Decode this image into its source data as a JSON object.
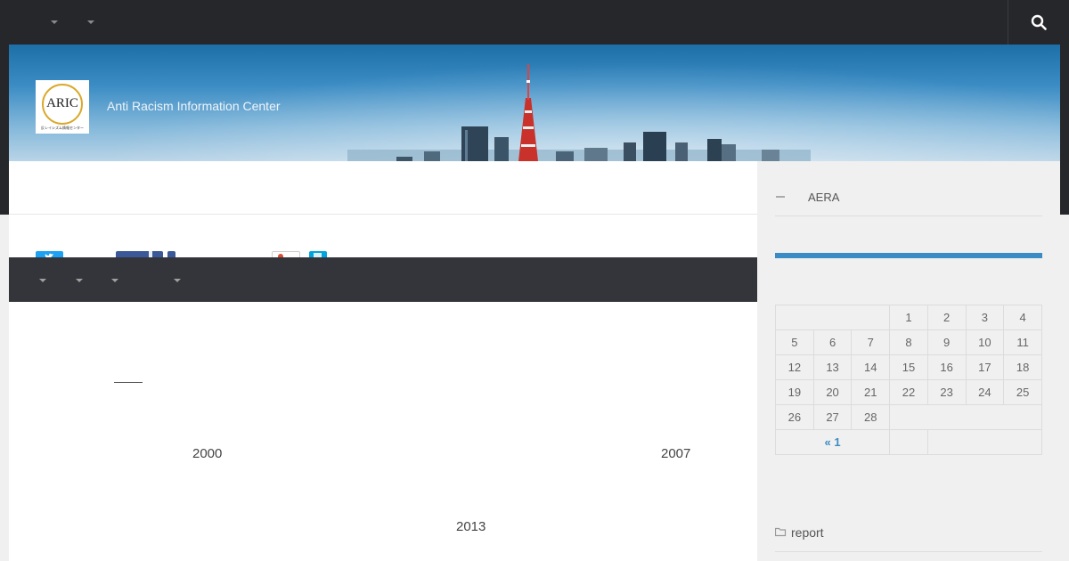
{
  "site": {
    "title": "Anti Racism Information Center",
    "logo_text": "ARIC",
    "logo_subtitle": "反レイシズム情報センター"
  },
  "topbar": {
    "search_icon": "search-icon"
  },
  "content": {
    "years": [
      "2000",
      "2007",
      "2013"
    ]
  },
  "sidebar": {
    "category_label": "AERA",
    "calendar": {
      "rows": [
        [
          "",
          "",
          "",
          "1",
          "2",
          "3",
          "4"
        ],
        [
          "5",
          "6",
          "7",
          "8",
          "9",
          "10",
          "11"
        ],
        [
          "12",
          "13",
          "14",
          "15",
          "16",
          "17",
          "18"
        ],
        [
          "19",
          "20",
          "21",
          "22",
          "23",
          "24",
          "25"
        ],
        [
          "26",
          "27",
          "28",
          "",
          "",
          "",
          ""
        ]
      ],
      "prev_link": "« 1"
    },
    "report_label": "report"
  },
  "colors": {
    "topbar_bg": "#26272b",
    "subnav_bg": "#34353a",
    "accent": "#3b8cc4",
    "twitter": "#1da1f2",
    "facebook": "#3b5998",
    "googleplus": "#dd4b39",
    "hatena": "#00a4de"
  }
}
